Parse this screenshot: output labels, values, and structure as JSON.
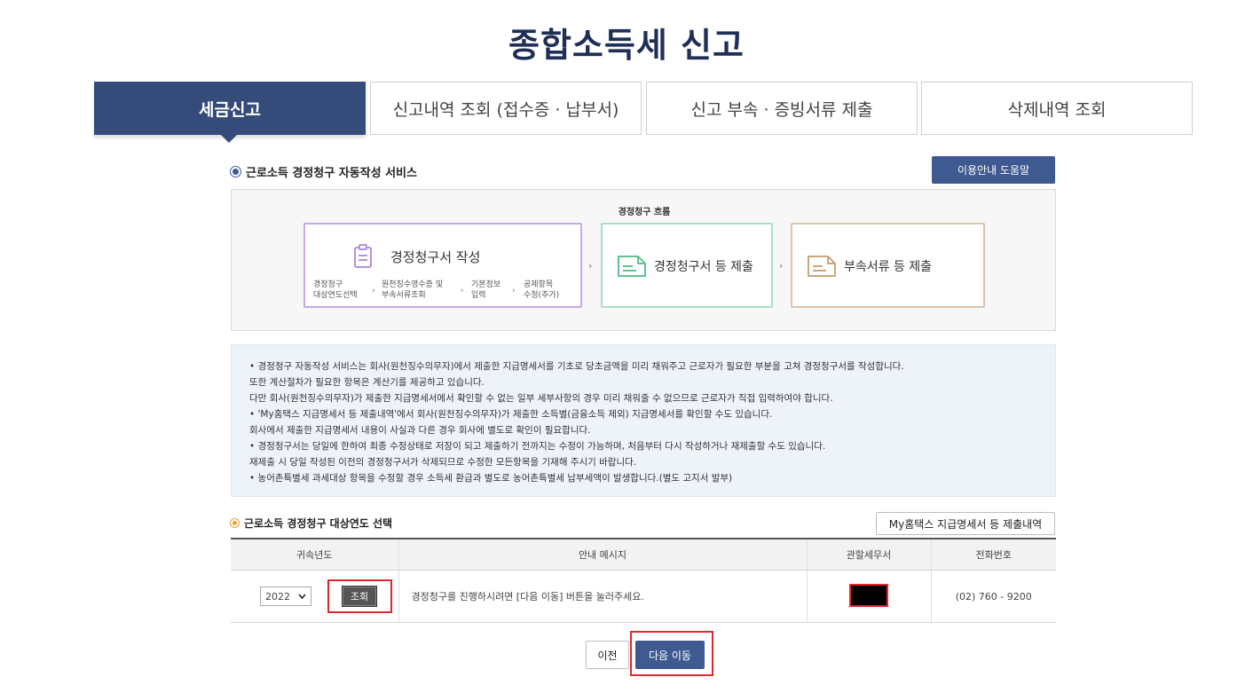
{
  "page": {
    "title": "종합소득세 신고"
  },
  "tabs": [
    {
      "label": "세금신고",
      "active": true
    },
    {
      "label": "신고내역 조회 (접수증 · 납부서)",
      "active": false
    },
    {
      "label": "신고 부속 · 증빙서류 제출",
      "active": false
    },
    {
      "label": "삭제내역 조회",
      "active": false
    }
  ],
  "service": {
    "title": "근로소득 경정청구 자동작성 서비스",
    "help_button": "이용안내 도움말"
  },
  "flow": {
    "title": "경정청구 흐름",
    "step1": {
      "label": "경정청구서 작성",
      "subs": [
        [
          "경정청구",
          "대상연도선택"
        ],
        [
          "원천징수영수증 및",
          "부속서류조회"
        ],
        [
          "기본정보",
          "입력"
        ],
        [
          "공제항목",
          "수정(추가)"
        ]
      ]
    },
    "step2": {
      "label": "경정청구서 등 제출"
    },
    "step3": {
      "label": "부속서류 등 제출"
    },
    "arrow": "›"
  },
  "notice": {
    "lines": [
      "• 경정청구 자동작성 서비스는 회사(원천징수의무자)에서 제출한 지급명세서를 기초로 당초금액을 미리 채워주고 근로자가 필요한 부분을 고쳐 경정청구서를 작성합니다.",
      "   또한 계산절차가 필요한 항목은 계산기를 제공하고 있습니다.",
      "   다만 회사(원천징수의무자)가 제출한 지급명세서에서 확인할 수 없는 일부 세부사항의 경우 미리 채워줄 수 없으므로 근로자가 직접 입력하여야 합니다.",
      "• 'My홈택스 지급명세서 등 제출내역'에서 회사(원천징수의무자)가 제출한 소득별(금융소득 제외) 지급명세서를 확인할 수도 있습니다.",
      "   회사에서 제출한 지급명세서 내용이 사실과 다른 경우 회사에 별도로 확인이 필요합니다.",
      "• 경정청구서는 당일에 한하여 최종 수정상태로 저장이 되고 제출하기 전까지는 수정이 가능하며, 처음부터 다시 작성하거나 재제출할 수도 있습니다.",
      "   재제출 시 당일 작성된 이전의 경정청구서가 삭제되므로 수정한 모든항목을 기재해 주시기 바랍니다.",
      "• 농어촌특별세 과세대상 항목을 수정할 경우 소득세 환급과 별도로 농어촌특별세 납부세액이 발생합니다.(별도 고지서 발부)"
    ]
  },
  "target": {
    "title": "근로소득 경정청구 대상연도 선택",
    "my_hometax_button": "My홈택스 지급명세서 등 제출내역"
  },
  "table": {
    "headers": [
      "귀속년도",
      "안내 메시지",
      "관할세무서",
      "전화번호"
    ],
    "row": {
      "year": "2022",
      "lookup_button": "조회",
      "message": "경정청구를 진행하시려면 [다음 이동] 버튼을 눌러주세요.",
      "phone": "(02) 760 - 9200"
    }
  },
  "buttons": {
    "prev": "이전",
    "next": "다음 이동"
  },
  "colors": {
    "navy": "#354b7a",
    "button_blue": "#3f5a91",
    "highlight_red": "#e3262b",
    "purple": "#c9a8e6",
    "green": "#a7e0c3",
    "tan": "#d9c6a7"
  }
}
